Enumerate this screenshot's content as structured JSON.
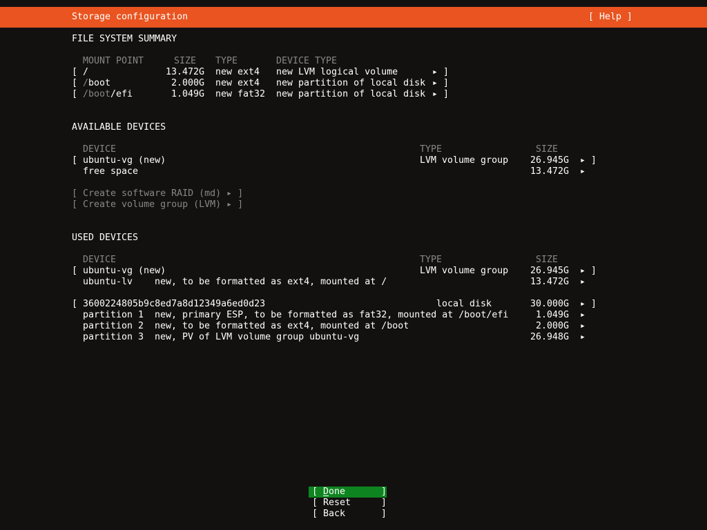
{
  "window": {
    "title": "Storage configuration",
    "help": "[ Help ]"
  },
  "glyphs": {
    "arrow": "▸",
    "lbracket": "[",
    "rbracket": "]"
  },
  "colors": {
    "bg": "#131110",
    "orange": "#e95420",
    "green": "#0e8420",
    "white": "#ffffff",
    "dim": "#8a8683"
  },
  "fs_summary": {
    "title": "FILE SYSTEM SUMMARY",
    "headers": {
      "mount": "MOUNT POINT",
      "size": "SIZE",
      "type": "TYPE",
      "device": "DEVICE TYPE"
    },
    "rows": [
      {
        "prefix": "",
        "mount": "/",
        "size": "13.472G",
        "type": "new ext4",
        "device": "new LVM logical volume"
      },
      {
        "prefix": "/",
        "mount": "boot",
        "size": "2.000G",
        "type": "new ext4",
        "device": "new partition of local disk"
      },
      {
        "prefix": "/boot",
        "mount": "/efi",
        "size": "1.049G",
        "type": "new fat32",
        "device": "new partition of local disk"
      }
    ]
  },
  "available": {
    "title": "AVAILABLE DEVICES",
    "headers": {
      "device": "DEVICE",
      "type": "TYPE",
      "size": "SIZE"
    },
    "vg": {
      "name": "ubuntu-vg (new)",
      "type": "LVM volume group",
      "size": "26.945G"
    },
    "free": {
      "name": "free space",
      "size": "13.472G"
    },
    "actions": [
      "[ Create software RAID (md) ▸ ]",
      "[ Create volume group (LVM) ▸ ]"
    ]
  },
  "used": {
    "title": "USED DEVICES",
    "headers": {
      "device": "DEVICE",
      "type": "TYPE",
      "size": "SIZE"
    },
    "vg": {
      "name": "ubuntu-vg (new)",
      "type": "LVM volume group",
      "size": "26.945G"
    },
    "lv": {
      "name": "ubuntu-lv",
      "detail": "new, to be formatted as ext4, mounted at /",
      "size": "13.472G"
    },
    "disk": {
      "name": "3600224805b9c8ed7a8d12349a6ed0d23",
      "type": "local disk",
      "size": "30.000G"
    },
    "partitions": [
      {
        "name": "partition 1",
        "detail": "new, primary ESP, to be formatted as fat32, mounted at /boot/efi",
        "size": "1.049G"
      },
      {
        "name": "partition 2",
        "detail": "new, to be formatted as ext4, mounted at /boot",
        "size": "2.000G"
      },
      {
        "name": "partition 3",
        "detail": "new, PV of LVM volume group ubuntu-vg",
        "size": "26.948G"
      }
    ]
  },
  "buttons": [
    {
      "label": "Done",
      "selected": true
    },
    {
      "label": "Reset",
      "selected": false
    },
    {
      "label": "Back",
      "selected": false
    }
  ]
}
